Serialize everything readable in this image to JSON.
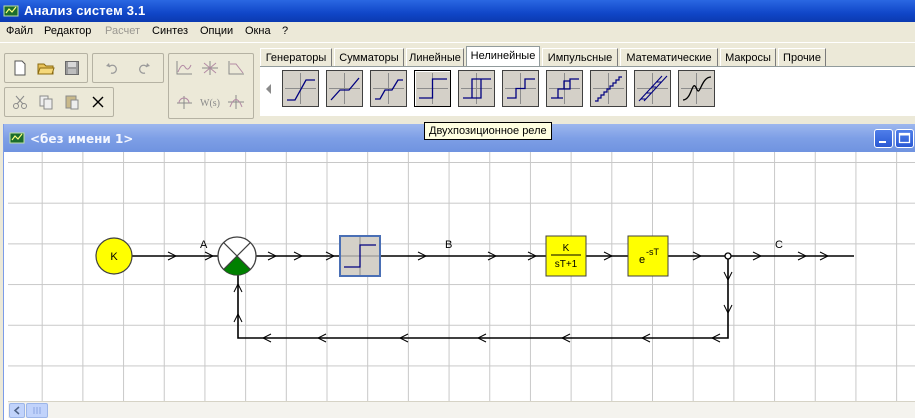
{
  "app": {
    "title": "Анализ систем 3.1"
  },
  "menu": [
    "Файл",
    "Редактор",
    "Расчет",
    "Синтез",
    "Опции",
    "Окна",
    "?"
  ],
  "library_tabs": [
    "Генераторы",
    "Сумматоры",
    "Линейные",
    "Нелинейные",
    "Импульсные",
    "Математические",
    "Макросы",
    "Прочие"
  ],
  "active_tab": "Нелинейные",
  "tooltip": "Двухпозиционное реле",
  "document": {
    "title": "<без имени 1>"
  },
  "diagram": {
    "source_label": "K",
    "signal_a": "A",
    "signal_b": "B",
    "signal_c": "C",
    "gain_num": "K",
    "gain_den": "sT+1",
    "delay_base": "e",
    "delay_exp": "-sT"
  },
  "colors": {
    "block_yellow": "#ffff00",
    "summer_green": "#008000",
    "titlebar": "#1046c8",
    "child_titlebar": "#7e9fe6",
    "relay_fill": "#d4d0c8"
  }
}
